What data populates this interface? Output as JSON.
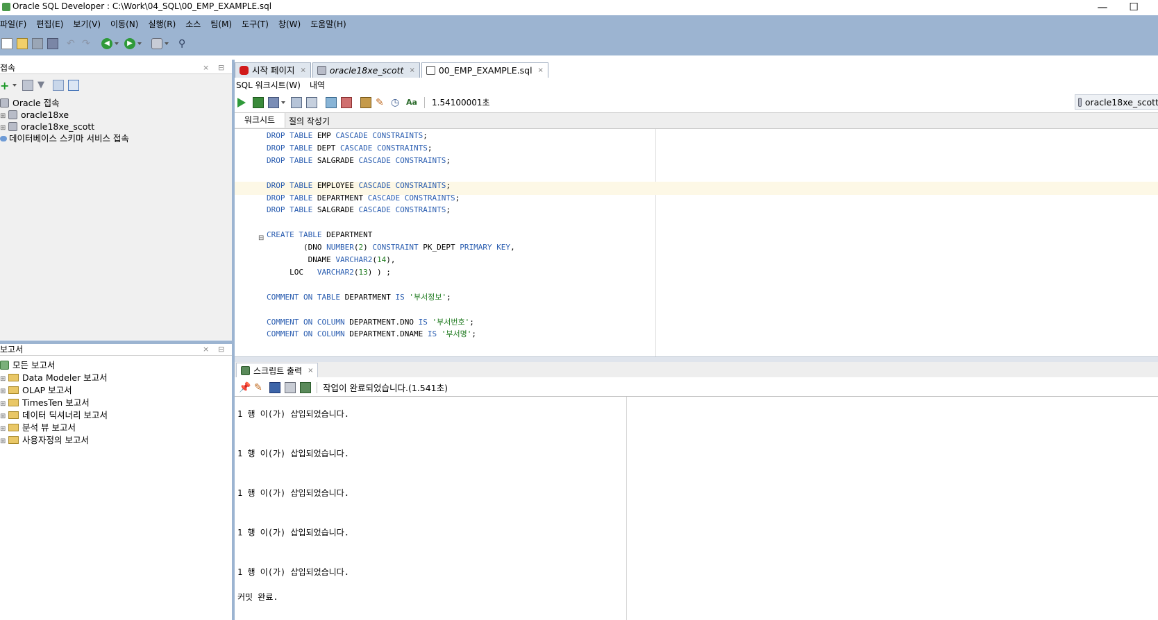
{
  "window": {
    "title": "Oracle SQL Developer : C:\\Work\\04_SQL\\00_EMP_EXAMPLE.sql",
    "minimize": "—",
    "maximize": "☐"
  },
  "menu": [
    "파일(F)",
    "편집(E)",
    "보기(V)",
    "이동(N)",
    "실행(R)",
    "소스",
    "팀(M)",
    "도구(T)",
    "창(W)",
    "도움말(H)"
  ],
  "connections_panel": {
    "title": "접속",
    "close": "×",
    "minimize": "⊟",
    "tree": [
      {
        "label": "Oracle 접속",
        "icon": "database-icon"
      },
      {
        "label": "oracle18xe",
        "icon": "database-icon"
      },
      {
        "label": "oracle18xe_scott",
        "icon": "database-icon"
      },
      {
        "label": "데이터베이스 스키마 서비스 접속",
        "icon": "cloud-icon"
      }
    ]
  },
  "reports_panel": {
    "title": "보고서",
    "close": "×",
    "minimize": "⊟",
    "tree": [
      {
        "label": "모든 보고서"
      },
      {
        "label": "Data Modeler 보고서"
      },
      {
        "label": "OLAP 보고서"
      },
      {
        "label": "TimesTen 보고서"
      },
      {
        "label": "데이터 딕셔너리 보고서"
      },
      {
        "label": "분석 뷰 보고서"
      },
      {
        "label": "사용자정의 보고서"
      }
    ]
  },
  "document_tabs": [
    {
      "label": "시작 페이지",
      "close": "×",
      "active": false
    },
    {
      "label": "oracle18xe_scott",
      "close": "×",
      "active": false
    },
    {
      "label": "00_EMP_EXAMPLE.sql",
      "close": "×",
      "active": true
    }
  ],
  "sub_tabs": {
    "worksheet": "SQL 워크시트(W)",
    "history": "내역"
  },
  "sql_toolbar": {
    "elapsed": "1.54100001초",
    "connection": "oracle18xe_scott"
  },
  "worksheet_tabs": {
    "worksheet": "워크시트",
    "query_builder": "질의 작성기"
  },
  "colors": {
    "chrome": "#9cb4d1",
    "keyword": "#2a5db0",
    "string": "#1e7a1e",
    "current_line": "#fdf8e6"
  },
  "code_lines": [
    "DROP TABLE EMP CASCADE CONSTRAINTS;",
    "DROP TABLE DEPT CASCADE CONSTRAINTS;",
    "DROP TABLE SALGRADE CASCADE CONSTRAINTS;",
    "",
    "DROP TABLE EMPLOYEE CASCADE CONSTRAINTS;",
    "DROP TABLE DEPARTMENT CASCADE CONSTRAINTS;",
    "DROP TABLE SALGRADE CASCADE CONSTRAINTS;",
    "",
    "CREATE TABLE DEPARTMENT",
    "        (DNO NUMBER(2) CONSTRAINT PK_DEPT PRIMARY KEY,",
    "         DNAME VARCHAR2(14),",
    "     LOC   VARCHAR2(13) ) ;",
    "",
    "COMMENT ON TABLE DEPARTMENT IS '부서정보';",
    "",
    "COMMENT ON COLUMN DEPARTMENT.DNO IS '부서번호';",
    "COMMENT ON COLUMN DEPARTMENT.DNAME IS '부서명';"
  ],
  "fold_marker": "⊟",
  "output_panel": {
    "title": "스크립트 출력",
    "close": "×",
    "status": "작업이 완료되었습니다.(1.541초)",
    "lines": [
      "1 행 이(가) 삽입되었습니다.",
      "1 행 이(가) 삽입되었습니다.",
      "1 행 이(가) 삽입되었습니다.",
      "1 행 이(가) 삽입되었습니다.",
      "1 행 이(가) 삽입되었습니다.",
      "커밋 완료."
    ]
  }
}
